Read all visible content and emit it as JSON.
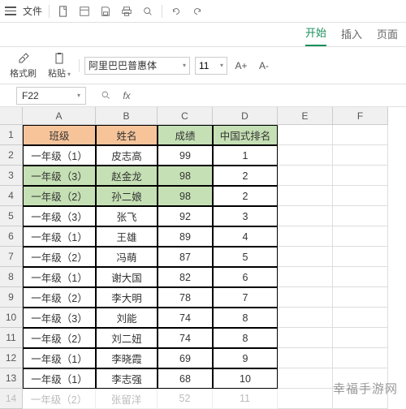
{
  "titlebar": {
    "file_label": "文件"
  },
  "tabs": {
    "start": "开始",
    "insert": "插入",
    "page": "页面"
  },
  "ribbon": {
    "format_painter": "格式刷",
    "paste": "粘贴",
    "font_name": "阿里巴巴普惠体",
    "font_size": "11",
    "increase_font": "A+",
    "decrease_font": "A-"
  },
  "formula_bar": {
    "cell_ref": "F22",
    "fx_label": "fx"
  },
  "grid": {
    "cols": [
      "A",
      "B",
      "C",
      "D",
      "E",
      "F"
    ],
    "header": {
      "class_col": "班级",
      "name_col": "姓名",
      "score_col": "成绩",
      "rank_col": "中国式排名"
    },
    "rows": [
      {
        "n": 1
      },
      {
        "n": 2,
        "class": "一年级（1）",
        "name": "皮志高",
        "score": 99,
        "rank": 1
      },
      {
        "n": 3,
        "class": "一年级（3）",
        "name": "赵金龙",
        "score": 98,
        "rank": 2,
        "hl": true
      },
      {
        "n": 4,
        "class": "一年级（2）",
        "name": "孙二娘",
        "score": 98,
        "rank": 2,
        "hl": true
      },
      {
        "n": 5,
        "class": "一年级（3）",
        "name": "张飞",
        "score": 92,
        "rank": 3
      },
      {
        "n": 6,
        "class": "一年级（1）",
        "name": "王雄",
        "score": 89,
        "rank": 4
      },
      {
        "n": 7,
        "class": "一年级（2）",
        "name": "冯萌",
        "score": 87,
        "rank": 5
      },
      {
        "n": 8,
        "class": "一年级（1）",
        "name": "谢大国",
        "score": 82,
        "rank": 6
      },
      {
        "n": 9,
        "class": "一年级（2）",
        "name": "李大明",
        "score": 78,
        "rank": 7
      },
      {
        "n": 10,
        "class": "一年级（3）",
        "name": "刘能",
        "score": 74,
        "rank": 8
      },
      {
        "n": 11,
        "class": "一年级（2）",
        "name": "刘二妞",
        "score": 74,
        "rank": 8
      },
      {
        "n": 12,
        "class": "一年级（1）",
        "name": "李晓霞",
        "score": 69,
        "rank": 9
      },
      {
        "n": 13,
        "class": "一年级（1）",
        "name": "李志强",
        "score": 68,
        "rank": 10
      },
      {
        "n": 14,
        "class": "一年级（2）",
        "name": "张留洋",
        "score": 52,
        "rank": 11,
        "faded": true
      }
    ]
  },
  "watermark": "幸福手游网"
}
